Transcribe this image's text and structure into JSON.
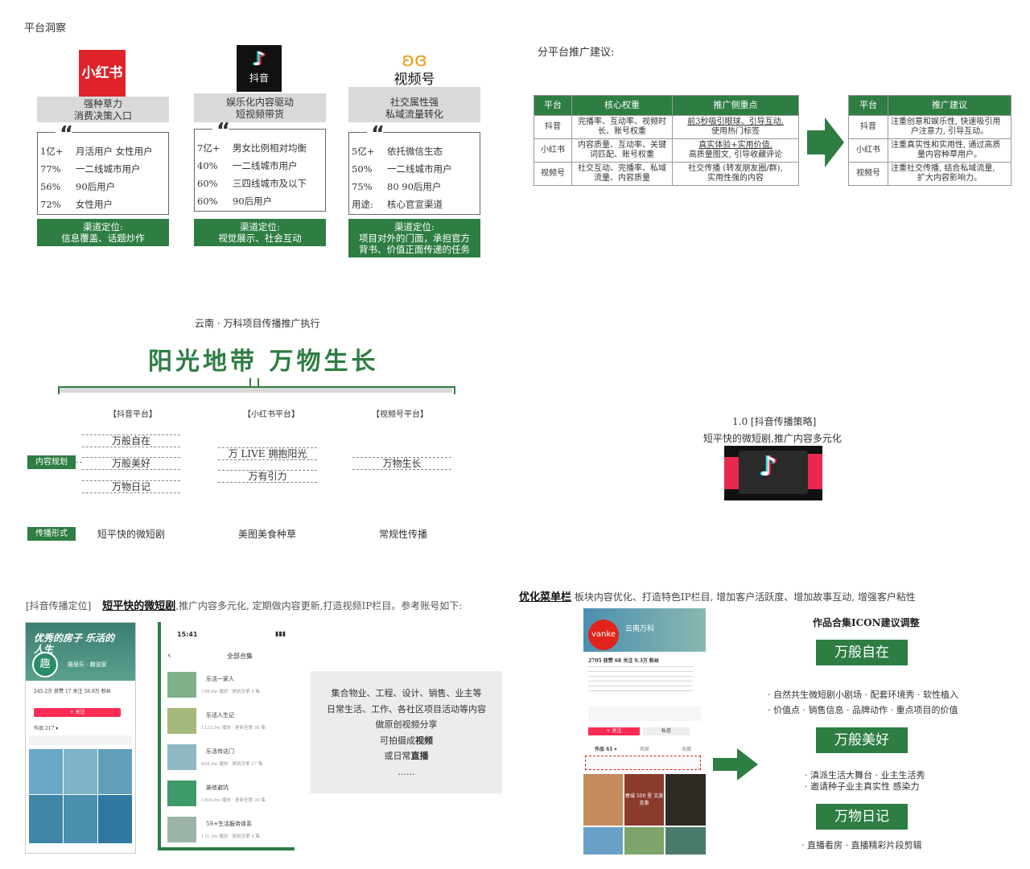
{
  "insight_title": "平台洞察",
  "platforms": [
    {
      "logo_text": "小红书",
      "logo_bg": "#e02329",
      "band_line1": "强种草力",
      "band_line2": "消费决策入口",
      "rows": [
        [
          "1亿+",
          "月活用户 女性用户"
        ],
        [
          "77%",
          "一二线城市用户"
        ],
        [
          "56%",
          "90后用户"
        ],
        [
          "72%",
          "女性用户"
        ]
      ],
      "pos_line1": "渠道定位:",
      "pos_line2": "信息覆盖、话题炒作"
    },
    {
      "logo_text": "抖音",
      "logo_bg": "#111111",
      "band_line1": "娱乐化内容驱动",
      "band_line2": "短视频带货",
      "rows": [
        [
          "7亿+",
          "男女比例相对均衡"
        ],
        [
          "40%",
          "一二线城市用户"
        ],
        [
          "60%",
          "三四线城市及以下"
        ],
        [
          "60%",
          "90后用户"
        ]
      ],
      "pos_line1": "渠道定位:",
      "pos_line2": "视觉展示、社会互动"
    },
    {
      "logo_text": "视频号",
      "logo_bg": "#ffffff",
      "band_line1": "社交属性强",
      "band_line2": "私域流量转化",
      "rows": [
        [
          "5亿+",
          "依托微信生态"
        ],
        [
          "50%",
          "一二线城市用户"
        ],
        [
          "75%",
          "80 90后用户"
        ],
        [
          "用途:",
          "核心官宣渠道"
        ]
      ],
      "pos_line1": "渠道定位:",
      "pos_line2": "项目对外的门面，承担官方",
      "pos_line3": "背书、价值正面传递的任务"
    }
  ],
  "promo_title": "分平台推广建议:",
  "table1": {
    "headers": [
      "平台",
      "核心权重",
      "推广侧重点"
    ],
    "rows": [
      {
        "p": "抖音",
        "w": "完播率、互动率、视频时长、账号权重",
        "f1": "前3秒吸引眼球、引导互动,",
        "f2": "使用热门标签"
      },
      {
        "p": "小红书",
        "w": "内容质量、互动率、关键词匹配、账号权重",
        "f1": "真实体验+实用价值,",
        "f2": "高质量图文, 引导收藏评论"
      },
      {
        "p": "视频号",
        "w": "社交互动、完播率、私域流量、内容质量",
        "f1": "社交传播 (转发朋友圈/群),",
        "f2": "实用性强的内容"
      }
    ]
  },
  "table2": {
    "headers": [
      "平台",
      "推广建议"
    ],
    "rows": [
      {
        "p": "抖音",
        "s1": "注重创意和娱乐性, 快速吸引用",
        "s2": "户注意力, 引导互动。"
      },
      {
        "p": "小红书",
        "s1": "注重真实性和实用性, 通过高质",
        "s2": "量内容种草用户。"
      },
      {
        "p": "视频号",
        "s1": "注重社交传播, 结合私域流量,",
        "s2": "扩大内容影响力。"
      }
    ]
  },
  "exec": {
    "subtitle": "云南 · 万科项目传播推广执行",
    "title": "阳光地带 万物生长",
    "col_douyin": "【抖音平台】",
    "col_xhs": "【小红书平台】",
    "col_sph": "【视频号平台】",
    "tag_content": "内容规划",
    "tag_form": "传播形式",
    "douyin_items": [
      "万般自在",
      "万般美好",
      "万物日记"
    ],
    "xhs_items": [
      "万 LIVE 拥抱阳光",
      "万有引力"
    ],
    "sph_items": [
      "万物生长"
    ],
    "form_douyin": "短平快的微短剧",
    "form_xhs": "美图美食种草",
    "form_sph": "常规性传播"
  },
  "strategy": {
    "line1": "1.0 [抖音传播策略]",
    "line2": "短平快的微短剧,推广内容多元化"
  },
  "position_text": {
    "prefix": "[抖音传播定位]",
    "highlight": "短平快的微短剧",
    "rest": ",推广内容多元化, 定期做内容更新,打造视频IP栏目。参考账号如下:"
  },
  "phone1": {
    "banner": "优秀的房子 乐活的人生",
    "brand": "雅居乐 · 趣说家",
    "stats": "245.2万 获赞  17 关注  58.8万 粉丝",
    "follow": "+ 关注",
    "works": "作品 217 ▾"
  },
  "phone2": {
    "time": "15:41",
    "header": "全部合集",
    "items": [
      {
        "name": "乐活一家人",
        "meta": "108.6w 播放 · 更新至第 4 集"
      },
      {
        "name": "乐活人生记",
        "meta": "1123.9w 播放 · 更新至第 38 集"
      },
      {
        "name": "乐活传达门",
        "meta": "858.0w 播放 · 更新至第 27 集"
      },
      {
        "name": "装修避坑",
        "meta": "1009.8w 播放 · 更新至第 39 集"
      },
      {
        "name": "5S+生活服务体系",
        "meta": "131.3w 播放 · 更新至第 4 集"
      }
    ]
  },
  "graybox": {
    "l1": "集合物业、工程、设计、销售、业主等",
    "l2": "日常生活、工作、各社区项目活动等内容",
    "l3": "做原创视频分享",
    "l4a": "可拍摄成",
    "l4b": "视频",
    "l5a": "或日常",
    "l5b": "直播",
    "l6": "......"
  },
  "menu": {
    "title_a": "优化菜单栏",
    "title_b": " 板块内容优化、打造特色IP栏目, 增加客户活跃度、增加故事互动, 增强客户粘性"
  },
  "phone3": {
    "logo": "vanke",
    "name": "云南万科",
    "stats": "2705 获赞  68 关注  9.3万 粉丝",
    "follow": "+ 关注",
    "msg": "私信",
    "works": "作品 61 ▾",
    "tab2": "商家",
    "tab3": "收藏",
    "overlay": "春城 500 里 文旅花事"
  },
  "icon_adjust": {
    "title": "作品合集ICON建议调整",
    "b1": "万般自在",
    "d1a": "· 自然共生微短剧小剧场 · 配套环境秀 · 软性植入",
    "d1b": "· 价值点 · 销售信息 · 品牌动作 · 重点项目的价值",
    "b2": "万般美好",
    "d2a": "· 滇派生活大舞台 · 业主生活秀",
    "d2b": "· 邀请种子业主真实性 感染力",
    "b3": "万物日记",
    "d3a": "· 直播看房 · 直播精彩片段剪辑"
  }
}
